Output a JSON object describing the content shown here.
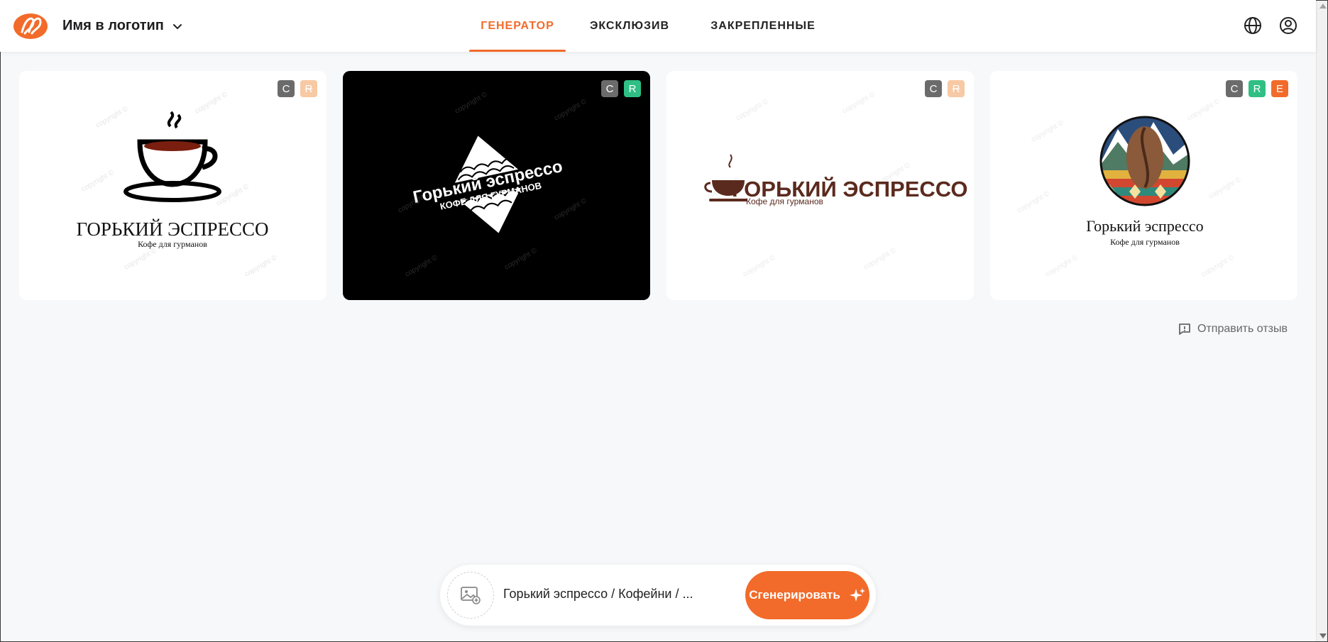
{
  "header": {
    "app_title": "Имя в логотип",
    "logo_icon": "brand-logo-icon",
    "tabs": [
      {
        "label": "ГЕНЕРАТОР",
        "active": true
      },
      {
        "label": "ЭКСКЛЮЗИВ",
        "active": false
      },
      {
        "label": "ЗАКРЕПЛЕННЫЕ",
        "active": false
      }
    ],
    "icons": [
      "globe-icon",
      "user-account-icon"
    ]
  },
  "cards": [
    {
      "theme": "light",
      "badges": [
        "C",
        "R"
      ],
      "title": "ГОРЬКИЙ ЭСПРЕССО",
      "subtitle": "Кофе для гурманов",
      "watermark": "copyright ©"
    },
    {
      "theme": "dark",
      "badges": [
        "C",
        "R"
      ],
      "title": "Горький эспрессо",
      "subtitle": "КОФЕ ДЛЯ ГУРМАНОВ",
      "watermark": "copyright ©"
    },
    {
      "theme": "light",
      "badges": [
        "C",
        "R"
      ],
      "title": "ГОРЬКИЙ ЭСПРЕССО",
      "subtitle": "Кофе для гурманов",
      "watermark": "copyright ©"
    },
    {
      "theme": "light",
      "badges": [
        "C",
        "R",
        "E"
      ],
      "title": "Горький эспрессо",
      "subtitle": "Кофе для гурманов",
      "watermark": "copyright ©"
    }
  ],
  "feedback": {
    "label": "Отправить отзыв",
    "icon": "feedback-icon"
  },
  "prompt": {
    "value": "Горький эспрессо / Кофейни / ...",
    "upload_icon": "image-upload-icon",
    "button_label": "Сгенерировать",
    "button_icon": "sparkle-icon"
  },
  "colors": {
    "accent": "#f26b2a",
    "badge_c": "#6b6b6b",
    "badge_r_active": "#2fbf84",
    "badge_r_inactive": "#f7c9a4",
    "page_bg": "#f7f8fa",
    "brown_text": "#5b2a1e"
  }
}
